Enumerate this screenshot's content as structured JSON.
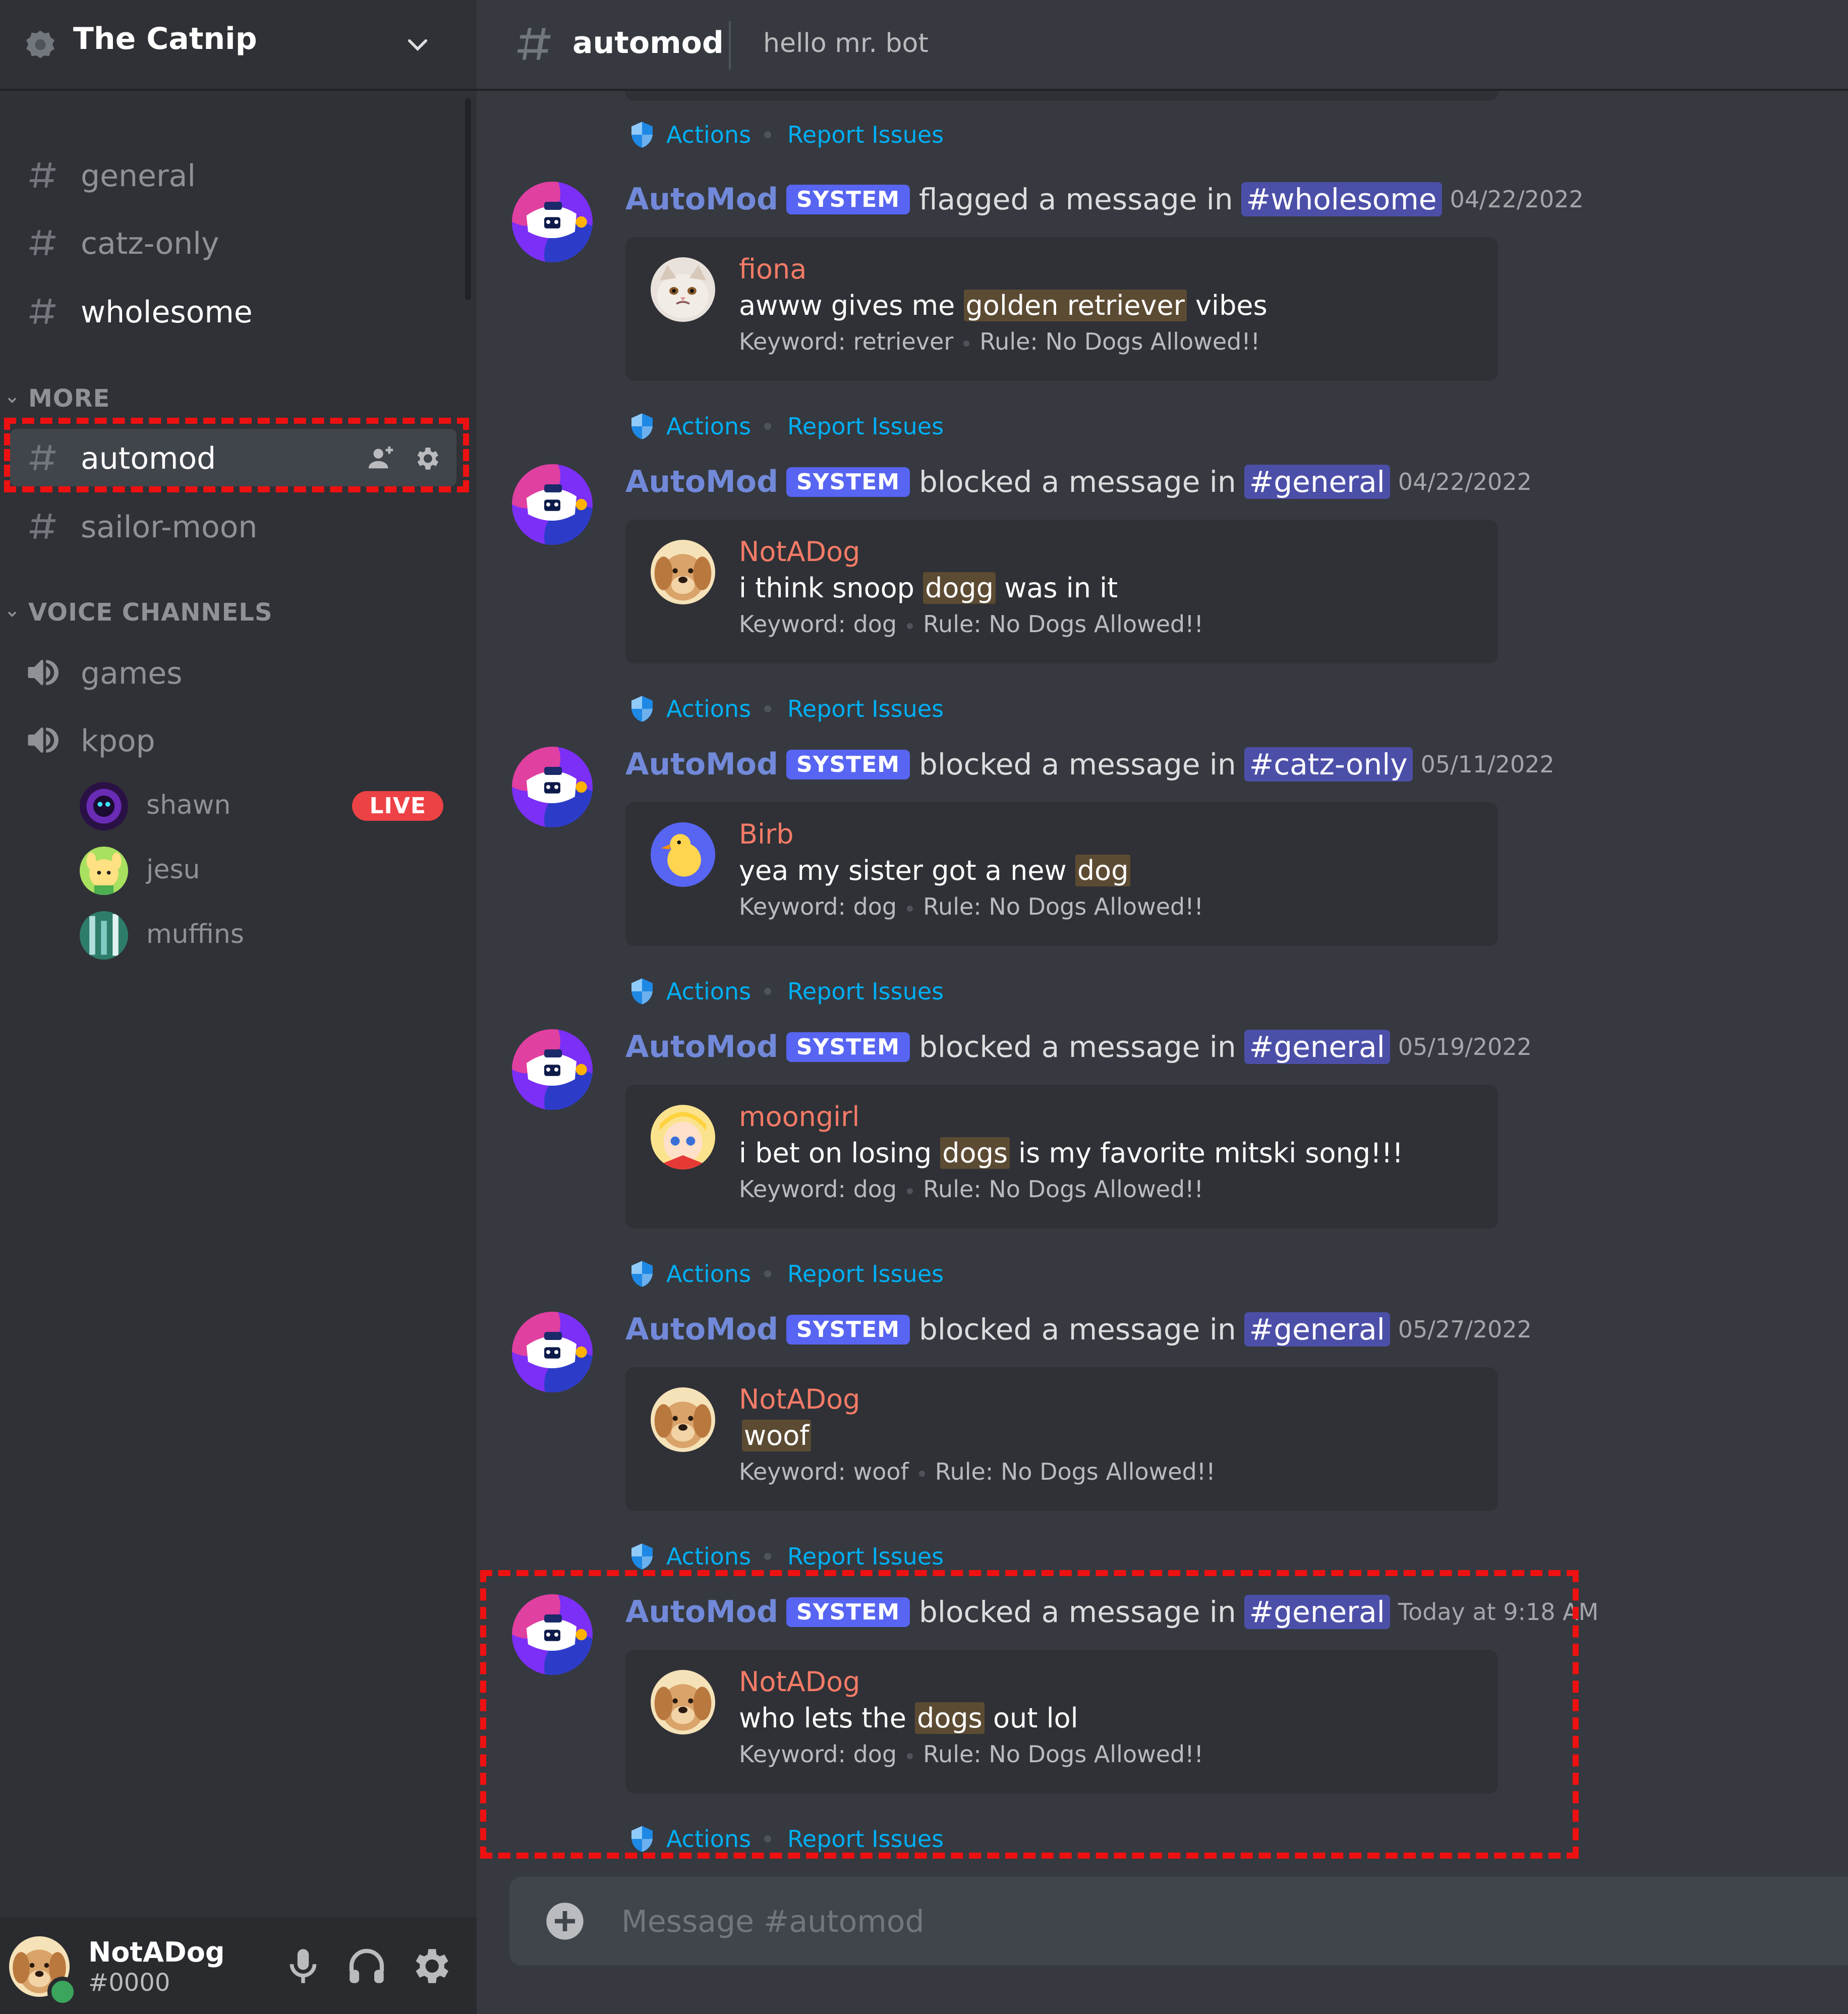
{
  "server": {
    "name": "The Catnip"
  },
  "sidebar": {
    "channels": [
      {
        "name": "general",
        "state": "normal"
      },
      {
        "name": "catz-only",
        "state": "normal"
      },
      {
        "name": "wholesome",
        "state": "unread"
      }
    ],
    "more_category": "MORE",
    "more_channels": [
      {
        "name": "automod",
        "state": "active"
      },
      {
        "name": "sailor-moon",
        "state": "normal"
      }
    ],
    "voice_category": "VOICE CHANNELS",
    "voice_channels": [
      {
        "name": "games"
      },
      {
        "name": "kpop"
      }
    ],
    "voice_users": [
      {
        "name": "shawn",
        "live": "LIVE"
      },
      {
        "name": "jesu"
      },
      {
        "name": "muffins"
      }
    ]
  },
  "user": {
    "name": "NotADog",
    "tag": "#0000"
  },
  "topbar": {
    "channel": "automod",
    "topic": "hello mr. bot"
  },
  "actions_label": "Actions",
  "report_label": "Report Issues",
  "bot_name": "AutoMod",
  "bot_badge": "SYSTEM",
  "messages": [
    {
      "verb": "flagged a message in",
      "channel": "#wholesome",
      "timestamp": "04/22/2022",
      "user": "fiona",
      "content_pre": "awww gives me ",
      "content_kw": "golden retriever",
      "content_post": " vibes",
      "keyword": "Keyword: retriever",
      "rule": "Rule: No Dogs Allowed!!"
    },
    {
      "verb": "blocked a message in",
      "channel": "#general",
      "timestamp": "04/22/2022",
      "user": "NotADog",
      "content_pre": "i think snoop ",
      "content_kw": "dogg",
      "content_post": " was in it",
      "keyword": "Keyword: dog",
      "rule": "Rule: No Dogs Allowed!!"
    },
    {
      "verb": "blocked a message in",
      "channel": "#catz-only",
      "timestamp": "05/11/2022",
      "user": "Birb",
      "content_pre": "yea my sister got a new ",
      "content_kw": "dog",
      "content_post": "",
      "keyword": "Keyword: dog",
      "rule": "Rule: No Dogs Allowed!!"
    },
    {
      "verb": "blocked a message in",
      "channel": "#general",
      "timestamp": "05/19/2022",
      "user": "moongirl",
      "content_pre": "i bet on losing ",
      "content_kw": "dogs",
      "content_post": " is my favorite mitski song!!!",
      "keyword": "Keyword: dog",
      "rule": "Rule: No Dogs Allowed!!"
    },
    {
      "verb": "blocked a message in",
      "channel": "#general",
      "timestamp": "05/27/2022",
      "user": "NotADog",
      "content_pre": "",
      "content_kw": "woof",
      "content_post": "",
      "keyword": "Keyword: woof",
      "rule": "Rule: No Dogs Allowed!!"
    },
    {
      "verb": "blocked a message in",
      "channel": "#general",
      "timestamp": "Today at 9:18 AM",
      "user": "NotADog",
      "content_pre": "who lets the ",
      "content_kw": "dogs",
      "content_post": " out lol",
      "keyword": "Keyword: dog",
      "rule": "Rule: No Dogs Allowed!!"
    }
  ],
  "composer": {
    "placeholder": "Message #automod"
  },
  "colors": {
    "accent": "#5865f2",
    "link": "#00aff4",
    "username": "#f47b67",
    "bot_name": "#7289da",
    "live": "#ed4245",
    "online": "#3ba55d",
    "highlight_box": "#ee1111"
  }
}
